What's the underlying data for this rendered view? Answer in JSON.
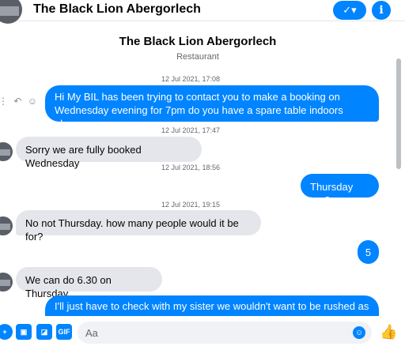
{
  "header": {
    "title": "The Black Lion Abergorlech",
    "menu_icon": "✓▾",
    "info_icon": "i"
  },
  "profile": {
    "name": "The Black Lion Abergorlech",
    "category": "Restaurant"
  },
  "messages": [
    {
      "type": "timestamp",
      "text": "12 Jul 2021, 17:08"
    },
    {
      "type": "out",
      "text": "Hi My BIL has been trying to contact you to make a booking on Wednesday evening for 7pm do you have a spare table indoors please."
    },
    {
      "type": "timestamp",
      "text": "12 Jul 2021, 17:47"
    },
    {
      "type": "in",
      "text": "Sorry we are fully booked Wednesday"
    },
    {
      "type": "timestamp",
      "text": "12 Jul 2021, 18:56"
    },
    {
      "type": "out",
      "text": "Thursday too?"
    },
    {
      "type": "timestamp",
      "text": "12 Jul 2021, 19:15"
    },
    {
      "type": "in",
      "text": "No not Thursday. how many people would it be for?"
    },
    {
      "type": "out",
      "text": "5"
    },
    {
      "type": "in",
      "text": "We can do 6.30 on Thursday"
    },
    {
      "type": "out",
      "text": "I'll just have to check with my sister we wouldn't want to be rushed as"
    }
  ],
  "message_actions": [
    "⋮",
    "↶",
    "☺"
  ],
  "composer": {
    "placeholder": "Aa",
    "icons": [
      "plus-icon",
      "photo-icon",
      "sticker-icon",
      "gif-icon"
    ],
    "gif_label": "GIF",
    "like_icon": "👍"
  },
  "colors": {
    "accent": "#0084ff",
    "incoming_bubble": "#e4e6eb",
    "muted_text": "#65676b"
  }
}
